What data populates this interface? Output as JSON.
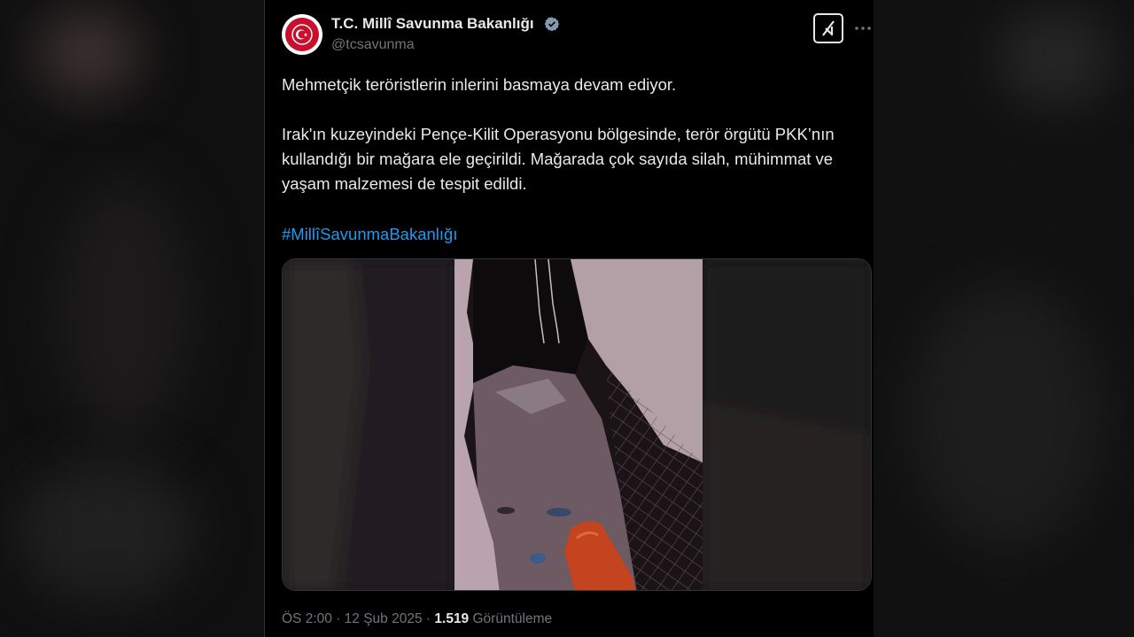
{
  "tweet": {
    "author_name": "T.C. Millî Savunma Bakanlığı",
    "author_handle": "@tcsavunma",
    "verified": true,
    "lines": [
      "Mehmetçik teröristlerin inlerini basmaya devam ediyor.",
      "Irak'ın kuzeyindeki Pençe-Kilit Operasyonu bölgesinde, terör örgütü PKK’nın",
      "kullandığı bir mağara ele geçirildi. Mağarada çok sayıda silah, mühimmat ve",
      "yaşam malzemesi de tespit edildi."
    ],
    "hashtag": "#MillîSavunmaBakanlığı",
    "time": "ÖS 2:00",
    "date": "12 Şub 2025",
    "views_count": "1.519",
    "views_label": "Görüntüleme",
    "separator": "·"
  },
  "icons": {
    "verified": "verified-badge-icon",
    "grok": "grok-icon",
    "more": "more-icon"
  },
  "colors": {
    "accent": "#1d9bf0",
    "background": "#000000",
    "text": "#e7e9ea",
    "muted": "#71767b",
    "avatar_red": "#c8102e"
  }
}
